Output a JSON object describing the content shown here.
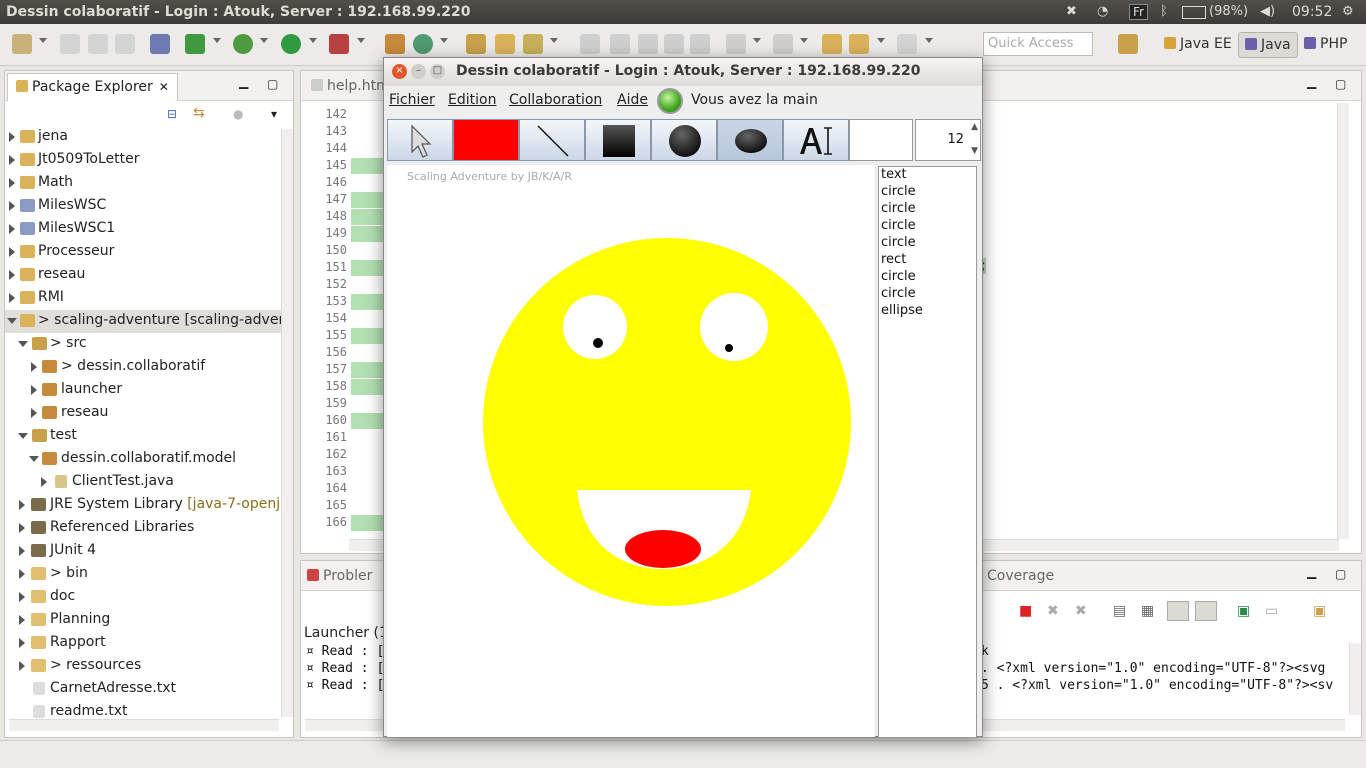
{
  "system_bar": {
    "title": "Dessin colaboratif - Login : Atouk, Server : 192.168.99.220",
    "keyboard": "Fr",
    "battery": "(98%)",
    "clock": "09:52"
  },
  "toolbar": {
    "quick_access_placeholder": "Quick Access",
    "perspectives": [
      "Java EE",
      "Java",
      "PHP"
    ]
  },
  "package_explorer": {
    "tab_label": "Package Explorer",
    "tab_close": "✕",
    "items": [
      {
        "label": "jena",
        "deco": ""
      },
      {
        "label": "Jt0509ToLetter",
        "deco": ""
      },
      {
        "label": "Math",
        "deco": ""
      },
      {
        "label": "MilesWSC",
        "deco": ""
      },
      {
        "label": "MilesWSC1",
        "deco": ""
      },
      {
        "label": "Processeur",
        "deco": ""
      },
      {
        "label": "reseau",
        "deco": ""
      },
      {
        "label": "RMI",
        "deco": ""
      },
      {
        "label": "> scaling-adventure  [scaling-adventu",
        "deco": ""
      },
      {
        "label": "> src",
        "deco": ""
      },
      {
        "label": "> dessin.collaboratif",
        "deco": ""
      },
      {
        "label": "launcher",
        "deco": ""
      },
      {
        "label": "reseau",
        "deco": ""
      },
      {
        "label": "test",
        "deco": ""
      },
      {
        "label": "dessin.collaboratif.model",
        "deco": ""
      },
      {
        "label": "ClientTest.java",
        "deco": ""
      },
      {
        "label": "JRE System Library ",
        "deco": "[java-7-openjdl"
      },
      {
        "label": "Referenced Libraries",
        "deco": ""
      },
      {
        "label": "JUnit 4",
        "deco": ""
      },
      {
        "label": "> bin",
        "deco": ""
      },
      {
        "label": "doc",
        "deco": ""
      },
      {
        "label": "Planning",
        "deco": ""
      },
      {
        "label": "Rapport",
        "deco": ""
      },
      {
        "label": "> ressources",
        "deco": ""
      },
      {
        "label": "CarnetAdresse.txt",
        "deco": ""
      },
      {
        "label": "readme.txt",
        "deco": ""
      }
    ]
  },
  "editor": {
    "tab_label": "help.htm",
    "line_numbers": [
      "142",
      "143",
      "144",
      "145",
      "146",
      "147",
      "148",
      "149",
      "150",
      "151",
      "152",
      "153",
      "154",
      "155",
      "156",
      "157",
      "158",
      "159",
      "160",
      "161",
      "162",
      "163",
      "164",
      "165",
      "166"
    ],
    "fragment": ";"
  },
  "bottom_panel": {
    "tab_label": "Probler",
    "coverage_label": "Coverage",
    "console_title": "Launcher (1)",
    "lines": [
      "¤ Read : [",
      "¤ Read : [",
      "¤ Read : ["
    ],
    "right_lines": [
      "k",
      ". <?xml version=\"1.0\" encoding=\"UTF-8\"?><svg",
      "5 . <?xml version=\"1.0\" encoding=\"UTF-8\"?><sv"
    ]
  },
  "dialog": {
    "title": "Dessin colaboratif - Login : Atouk, Server : 192.168.99.220",
    "menu": {
      "fichier": "Fichier",
      "edition": "Edition",
      "collaboration": "Collaboration",
      "aide": "Aide"
    },
    "status": "Vous avez la main",
    "font_size": "12",
    "watermark": "Scaling Adventure by JB/K/A/R",
    "color": "#ff0000",
    "shape_list": [
      "text",
      "circle",
      "circle",
      "circle",
      "circle",
      "rect",
      "circle",
      "circle",
      "ellipse"
    ]
  }
}
